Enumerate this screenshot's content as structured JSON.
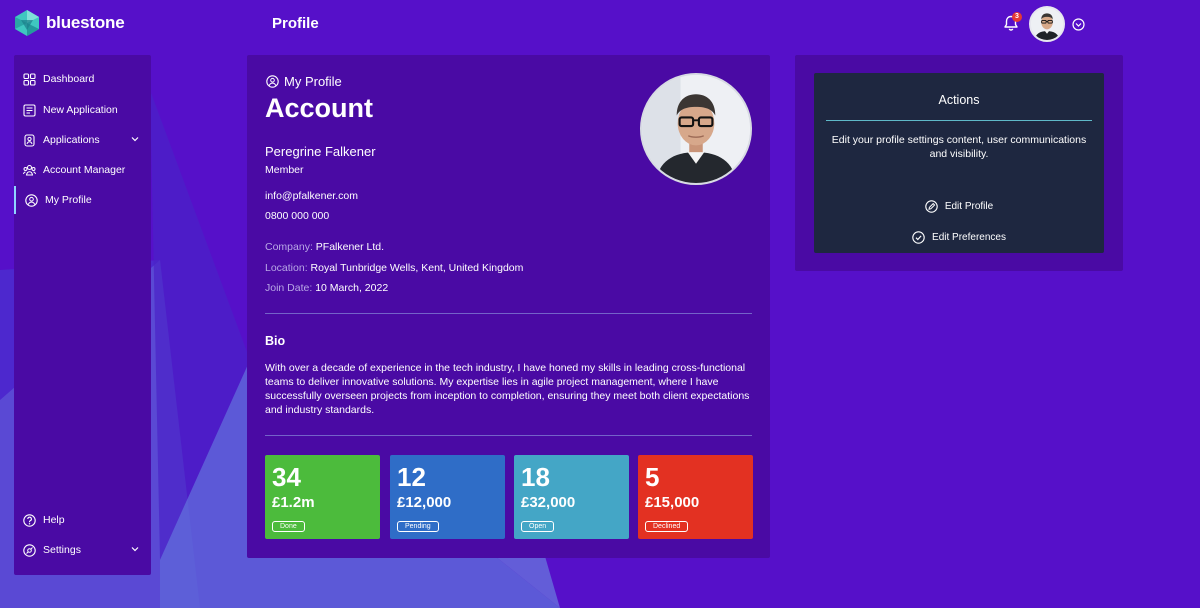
{
  "brand": {
    "name": "bluestone"
  },
  "header": {
    "title": "Profile",
    "notification_count": "3"
  },
  "sidebar": {
    "items": [
      {
        "label": "Dashboard",
        "icon": "dashboard-icon"
      },
      {
        "label": "New Application",
        "icon": "new-application-icon"
      },
      {
        "label": "Applications",
        "icon": "applications-icon",
        "has_submenu": true
      },
      {
        "label": "Account Manager",
        "icon": "account-manager-icon"
      },
      {
        "label": "My Profile",
        "icon": "user-circle-icon",
        "active": true
      }
    ],
    "footer_items": [
      {
        "label": "Help",
        "icon": "help-icon"
      },
      {
        "label": "Settings",
        "icon": "settings-icon",
        "has_submenu": true
      }
    ]
  },
  "profile": {
    "section_label": "My Profile",
    "title": "Account",
    "name": "Peregrine Falkener",
    "role": "Member",
    "email": "info@pfalkener.com",
    "phone": "0800 000 000",
    "company_label": "Company:",
    "company": "PFalkener Ltd.",
    "location_label": "Location:",
    "location": "Royal Tunbridge Wells, Kent, United Kingdom",
    "join_label": "Join Date:",
    "join_date": "10 March, 2022",
    "bio_heading": "Bio",
    "bio": "With over a decade of experience in the tech industry, I have honed my skills in leading cross-functional teams to deliver innovative solutions. My expertise lies in agile project management, where I have successfully overseen projects from inception to completion, ensuring they meet both client expectations and industry standards."
  },
  "stats": [
    {
      "count": "34",
      "amount": "£1.2m",
      "status": "Done",
      "color": "#4cbb3c"
    },
    {
      "count": "12",
      "amount": "£12,000",
      "status": "Pending",
      "color": "#2f6dc7"
    },
    {
      "count": "18",
      "amount": "£32,000",
      "status": "Open",
      "color": "#44a6c6"
    },
    {
      "count": "5",
      "amount": "£15,000",
      "status": "Declined",
      "color": "#e33122"
    }
  ],
  "actions": {
    "title": "Actions",
    "description": "Edit your profile settings content, user communications and visibility.",
    "buttons": [
      {
        "label": "Edit Profile",
        "icon": "edit-profile-icon"
      },
      {
        "label": "Edit Preferences",
        "icon": "check-circle-icon"
      }
    ]
  },
  "colors": {
    "background": "#5610c9",
    "panel": "#4a0aa4",
    "actions_panel": "#1e2740",
    "accent_line": "#5fb9c9",
    "active_indicator": "#8fd3ff"
  }
}
